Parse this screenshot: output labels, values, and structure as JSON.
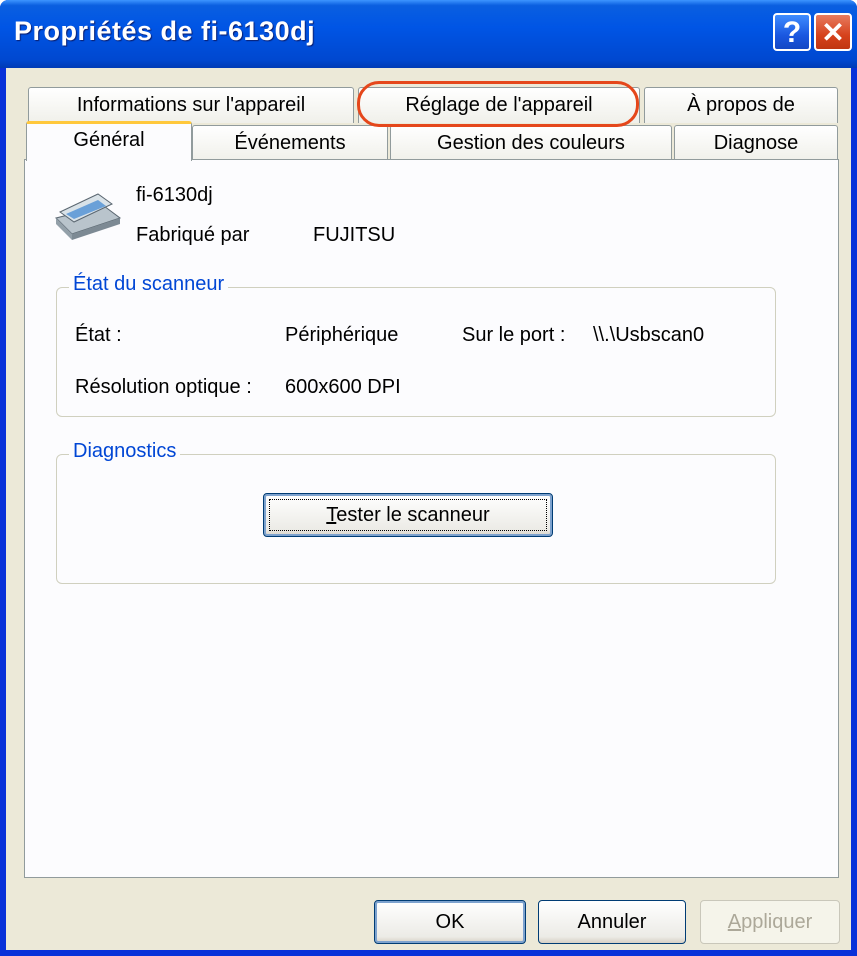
{
  "window": {
    "title": "Propriétés de fi-6130dj",
    "help_button": "?",
    "close_button": "✕"
  },
  "tabs_row_back": [
    {
      "label": "Informations sur l'appareil"
    },
    {
      "label": "Réglage de l'appareil"
    },
    {
      "label": "À propos de"
    }
  ],
  "tabs_row_front": [
    {
      "label": "Général",
      "active": true
    },
    {
      "label": "Événements"
    },
    {
      "label": "Gestion des couleurs"
    },
    {
      "label": "Diagnose"
    }
  ],
  "device": {
    "name": "fi-6130dj",
    "manufacturer_label": "Fabriqué par",
    "manufacturer_value": "FUJITSU",
    "icon": "scanner-icon"
  },
  "status_group": {
    "title": "État du scanneur",
    "state_label": "État :",
    "state_value": "Périphérique",
    "port_label": "Sur le port :",
    "port_value": "\\\\.\\Usbscan0",
    "resolution_label": "Résolution optique :",
    "resolution_value": "600x600 DPI"
  },
  "diagnostics_group": {
    "title": "Diagnostics",
    "test_button_accel": "T",
    "test_button_rest": "ester le scanneur"
  },
  "footer": {
    "ok_label": "OK",
    "cancel_label": "Annuler",
    "apply_accel": "A",
    "apply_rest": "ppliquer"
  },
  "colors": {
    "title_bar": "#0055e5",
    "groupbox_title": "#0046d5",
    "highlight_ring": "#e5471b"
  }
}
